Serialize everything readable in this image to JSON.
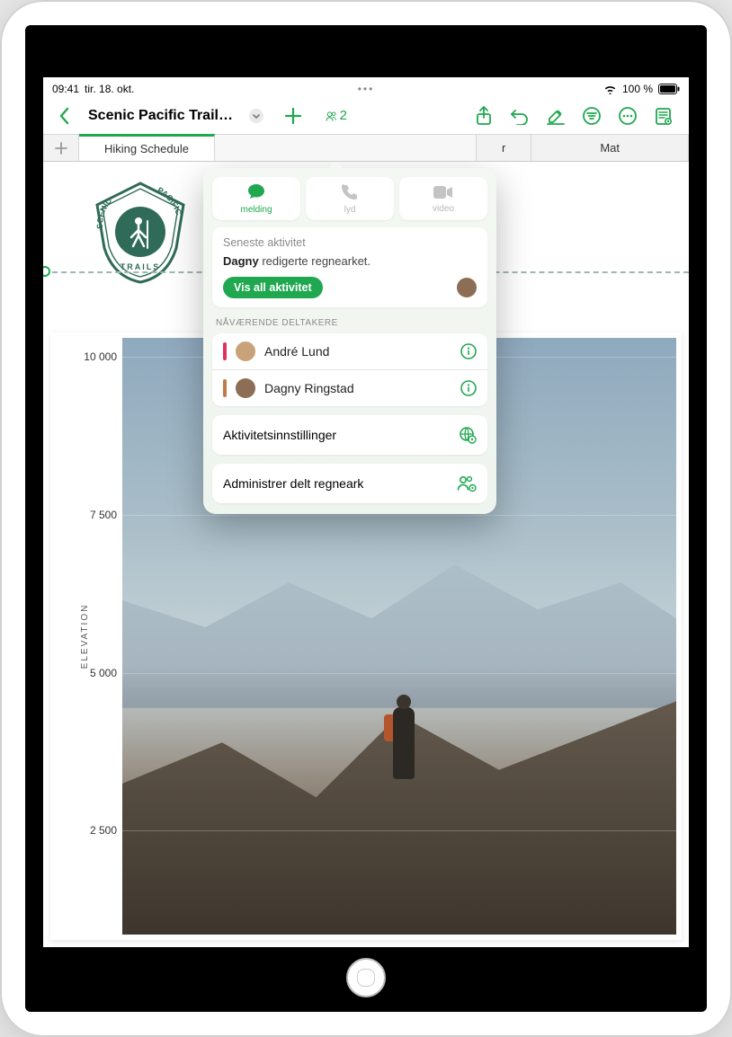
{
  "status": {
    "time": "09:41",
    "date": "tir. 18. okt.",
    "battery_pct": "100 %"
  },
  "toolbar": {
    "document_title": "Scenic Pacific Trail Se...",
    "collaborator_count": "2"
  },
  "tabs": {
    "first": "Hiking Schedule",
    "partial_middle": "r",
    "last": "Mat"
  },
  "popover": {
    "pill_message": "melding",
    "pill_audio": "lyd",
    "pill_video": "video",
    "recent_heading": "Seneste aktivitet",
    "activity_actor": "Dagny",
    "activity_text": " redigerte regnearket.",
    "show_all_button": "Vis all aktivitet",
    "participants_heading": "NÅVÆRENDE DELTAKERE",
    "participants": [
      {
        "name": "André Lund",
        "color": "#e0315e"
      },
      {
        "name": "Dagny Ringstad",
        "color": "#c17a4a"
      }
    ],
    "activity_settings": "Aktivitetsinnstillinger",
    "manage_shared": "Administrer delt regneark"
  },
  "chart_data": {
    "type": "bar",
    "ylabel": "ELEVATION",
    "y_ticks": [
      "10 000",
      "7 500",
      "5 000",
      "2 500"
    ],
    "ylim": [
      0,
      10000
    ],
    "categories": [],
    "values": []
  },
  "logo_text": {
    "top": "SCENIC",
    "mid": "PACIFIC",
    "bottom": "TRAILS"
  }
}
